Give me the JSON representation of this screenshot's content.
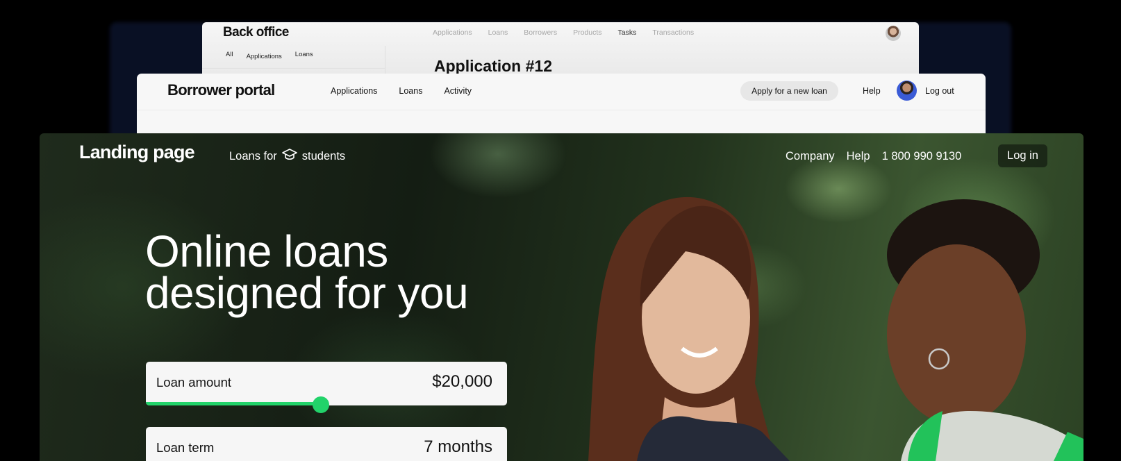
{
  "back_office": {
    "logo": "Back office",
    "nav": [
      "Applications",
      "Loans",
      "Borrowers",
      "Products",
      "Tasks",
      "Transactions"
    ],
    "active_nav": "Tasks",
    "tabs": [
      "All",
      "Applications",
      "Loans"
    ],
    "title": "Application #12"
  },
  "borrower_portal": {
    "logo": "Borrower portal",
    "nav": [
      "Applications",
      "Loans",
      "Activity"
    ],
    "apply_label": "Apply for a new loan",
    "help_label": "Help",
    "logout_label": "Log out"
  },
  "landing": {
    "logo": "Landing page",
    "loans_for_prefix": "Loans for",
    "loans_for_suffix": "students",
    "nav": {
      "company": "Company",
      "help": "Help",
      "phone": "1 800 990 9130"
    },
    "login_label": "Log in",
    "headline_line1": "Online loans",
    "headline_line2": "designed for you",
    "loan_amount": {
      "label": "Loan amount",
      "value": "$20,000",
      "slider_fraction": 0.485
    },
    "loan_term": {
      "label": "Loan term",
      "value": "7 months"
    }
  },
  "colors": {
    "accent_green": "#22d36a",
    "landing_text": "#ffffff",
    "portal_bg": "#f7f7f7"
  },
  "icons": {
    "graduation_cap": "graduation-cap-icon"
  }
}
